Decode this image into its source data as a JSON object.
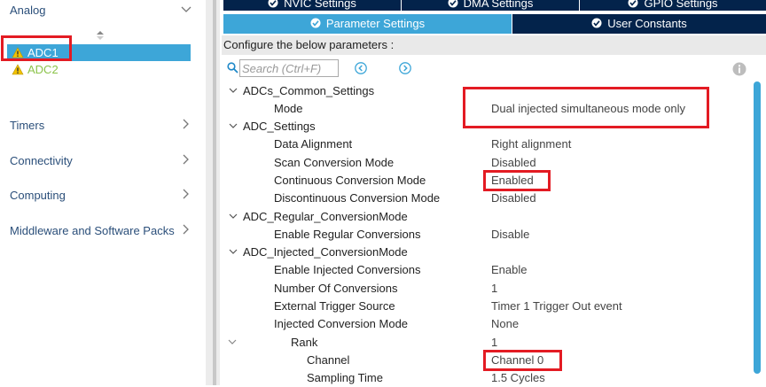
{
  "sidebar": {
    "categories": {
      "analog": "Analog",
      "timers": "Timers",
      "connectivity": "Connectivity",
      "computing": "Computing",
      "middleware": "Middleware and Software Packs"
    },
    "items": [
      {
        "label": "ADC1",
        "selected": true,
        "icon": "warning-icon"
      },
      {
        "label": "ADC2",
        "selected": false,
        "icon": "warning-icon"
      }
    ]
  },
  "tabs": {
    "nvic": "NVIC Settings",
    "dma": "DMA Settings",
    "gpio": "GPIO Settings",
    "param": "Parameter Settings",
    "user": "User Constants",
    "active": "Parameter Settings"
  },
  "config": {
    "label": "Configure the below parameters :",
    "search_placeholder": "Search (Ctrl+F)"
  },
  "params": [
    {
      "name": "ADCs_Common_Settings",
      "value": "",
      "group": true
    },
    {
      "name": "Mode",
      "value": "Dual injected simultaneous mode only"
    },
    {
      "name": "ADC_Settings",
      "value": "",
      "group": true
    },
    {
      "name": "Data Alignment",
      "value": "Right alignment"
    },
    {
      "name": "Scan Conversion Mode",
      "value": "Disabled"
    },
    {
      "name": "Continuous Conversion Mode",
      "value": "Enabled"
    },
    {
      "name": "Discontinuous Conversion Mode",
      "value": "Disabled"
    },
    {
      "name": "ADC_Regular_ConversionMode",
      "value": "",
      "group": true
    },
    {
      "name": "Enable Regular Conversions",
      "value": "Disable"
    },
    {
      "name": "ADC_Injected_ConversionMode",
      "value": "",
      "group": true
    },
    {
      "name": "Enable Injected Conversions",
      "value": "Enable"
    },
    {
      "name": "Number Of Conversions",
      "value": "1"
    },
    {
      "name": "External Trigger Source",
      "value": "Timer 1 Trigger Out event"
    },
    {
      "name": "Injected Conversion Mode",
      "value": "None"
    },
    {
      "name": "Rank",
      "value": "1",
      "group": true
    },
    {
      "name": "Channel",
      "value": "Channel 0"
    },
    {
      "name": "Sampling Time",
      "value": "1.5 Cycles"
    }
  ],
  "colors": {
    "accent": "#3da6d8",
    "dark_tab": "#03234b",
    "highlight_box": "#e31b23",
    "adc2_text": "#8bc34a"
  }
}
